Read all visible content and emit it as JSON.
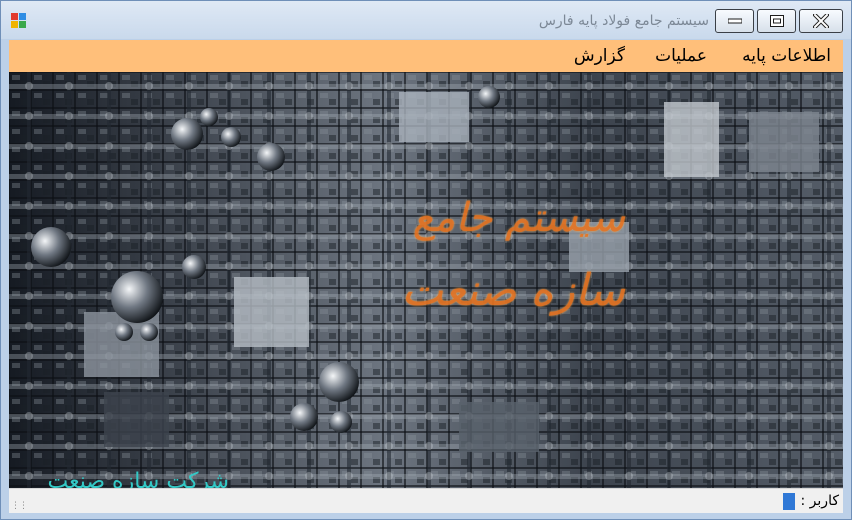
{
  "window": {
    "title": "سیستم جامع فولاد پایه فارس",
    "controls": {
      "minimize": "minimize-icon",
      "maximize": "maximize-icon",
      "close": "close-icon"
    }
  },
  "menu": {
    "items": [
      {
        "label": "اطلاعات پایه"
      },
      {
        "label": "عملیات"
      },
      {
        "label": "گزارش"
      }
    ]
  },
  "splash": {
    "title_line1": "سیستم جامع",
    "title_line2": "سازه صنعت",
    "footer_partial": "شرکت سازه صنعت"
  },
  "status": {
    "user_label": "کاربر :",
    "user_value": ""
  },
  "colors": {
    "menubar": "#ffbf7a",
    "splash_text": "#e87522",
    "footer_text": "#33c9c6",
    "titlebar": "#c9d9ec",
    "user_highlight": "#2f78d6"
  }
}
